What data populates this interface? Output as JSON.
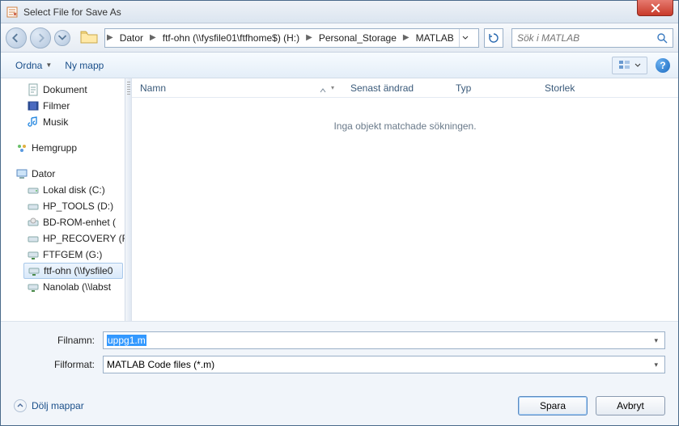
{
  "title": "Select File for Save As",
  "breadcrumb": {
    "root": "Dator",
    "drive": "ftf-ohn (\\\\fysfile01\\ftfhome$) (H:)",
    "folder1": "Personal_Storage",
    "folder2": "MATLAB"
  },
  "search": {
    "placeholder": "Sök i MATLAB"
  },
  "toolbar": {
    "organize": "Ordna",
    "newfolder": "Ny mapp"
  },
  "sidebar": {
    "documents": "Dokument",
    "videos": "Filmer",
    "music": "Musik",
    "homegroup": "Hemgrupp",
    "computer": "Dator",
    "drive_c": "Lokal disk (C:)",
    "drive_d": "HP_TOOLS (D:)",
    "drive_bd": "BD-ROM-enhet (",
    "drive_f": "HP_RECOVERY (F",
    "drive_g": "FTFGEM (G:)",
    "drive_h": "ftf-ohn (\\\\fysfile0",
    "drive_nano": "Nanolab (\\\\labst"
  },
  "columns": {
    "name": "Namn",
    "modified": "Senast ändrad",
    "type": "Typ",
    "size": "Storlek"
  },
  "empty_message": "Inga objekt matchade sökningen.",
  "form": {
    "filename_label": "Filnamn:",
    "filename_value": "uppg1.m",
    "format_label": "Filformat:",
    "format_value": "MATLAB Code files (*.m)"
  },
  "footer": {
    "hide_folders": "Dölj mappar",
    "save": "Spara",
    "cancel": "Avbryt"
  }
}
